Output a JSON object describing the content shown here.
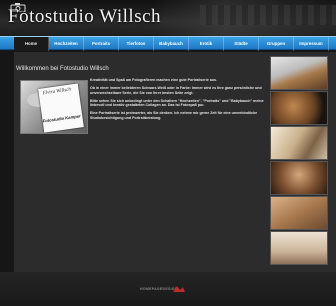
{
  "header": {
    "site_title": "Fotostudio Willsch"
  },
  "nav": {
    "items": [
      {
        "label": "Home",
        "active": true
      },
      {
        "label": "Hochzeiten"
      },
      {
        "label": "Portraits"
      },
      {
        "label": "Tierfotos"
      },
      {
        "label": "Babybauch"
      },
      {
        "label": "Erotik"
      },
      {
        "label": "Städte"
      },
      {
        "label": "Gruppen"
      },
      {
        "label": "Impressum"
      }
    ]
  },
  "main": {
    "welcome_title": "Willkommen bei Fotostudio Willsch",
    "photo_caption_top": "Elvira Willsch",
    "photo_caption_bottom": "Fotostudio Kamper",
    "paragraphs": [
      "Kreativität und Spaß am Fotografieren machen eine gute Portraitserie aus.",
      "Ob in einer immer beliebteren Schwarz-Weiß oder in Farbe: Immer wird es Ihre ganz persönliche und unverwechselbare Serie, die Sie von Ihrer besten Seite zeigt.",
      "Bitte sehen Sie sich unbedingt unter den Schaltern \"Hochzeiten\", \"Portraits\" und \"Babybauch\" meine liebevoll und kreativ gestalteten Collagen an. Das ist Fotospaß pur.",
      "Eine Portraitserie ist preiswerter, als Sie denken. Ich nehme mir gerne Zeit für eine unverbindliche Studiobesichtigung und Portraitberatung."
    ]
  },
  "gallery": {
    "thumb_count": 6
  },
  "footer": {
    "credit": "HOMEPAGEDESIGN"
  },
  "colors": {
    "nav_blue": "#2a8ad6",
    "background": "#161616",
    "panel": "#2c2c2c"
  }
}
